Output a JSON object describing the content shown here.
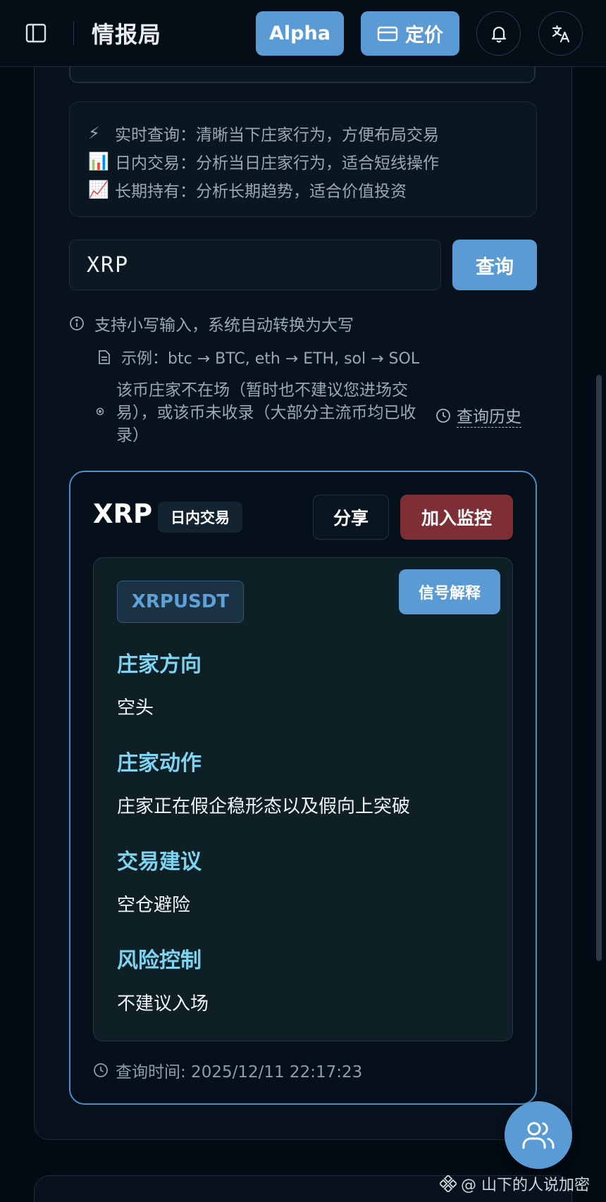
{
  "header": {
    "brand": "情报局",
    "alpha_label": "Alpha",
    "pricing_label": "定价"
  },
  "modes": [
    {
      "emoji": "⚡",
      "text": "实时查询：清晰当下庄家行为，方便布局交易"
    },
    {
      "emoji": "📊",
      "text": "日内交易：分析当日庄家行为，适合短线操作"
    },
    {
      "emoji": "📈",
      "text": "长期持有：分析长期趋势，适合价值投资"
    }
  ],
  "search": {
    "value": "XRP",
    "button_label": "查询"
  },
  "hints": {
    "lowercase": "支持小写输入，系统自动转换为大写",
    "example": "示例：btc → BTC, eth → ETH, sol → SOL",
    "not_present": "该币庄家不在场（暂时也不建议您进场交易），或该币未收录（大部分主流币均已收录）",
    "history_link": "查询历史"
  },
  "result": {
    "coin": "XRP",
    "mode_badge": "日内交易",
    "share_label": "分享",
    "monitor_label": "加入监控",
    "pair": "XRPUSDT",
    "explain_label": "信号解释",
    "sections": [
      {
        "title": "庄家方向",
        "value": "空头"
      },
      {
        "title": "庄家动作",
        "value": "庄家正在假企稳形态以及假向上突破"
      },
      {
        "title": "交易建议",
        "value": "空仓避险"
      },
      {
        "title": "风险控制",
        "value": "不建议入场"
      }
    ],
    "query_time": "查询时间: 2025/12/11 22:17:23"
  },
  "watermark": "@ 山下的人说加密",
  "colors": {
    "accent": "#5b9bd5",
    "danger": "#7d2f35",
    "section_title": "#7dd3f0",
    "background": "#020b13"
  }
}
